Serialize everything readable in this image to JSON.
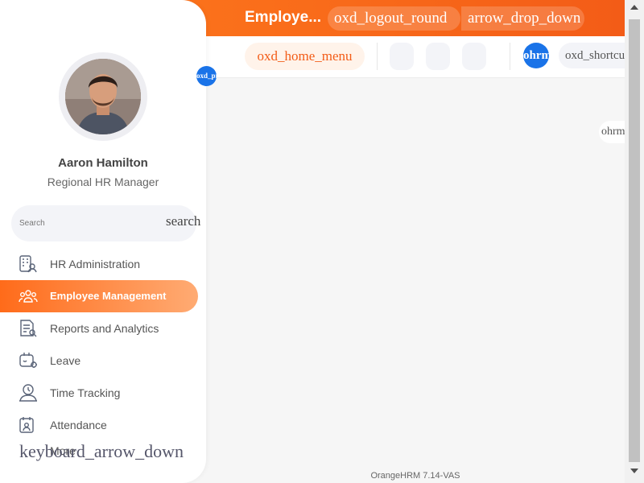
{
  "header": {
    "title": "Employe...",
    "logout_icon_text": "oxd_logout_round",
    "dropdown_icon_text": "arrow_drop_down"
  },
  "subbar": {
    "home_menu_text": "oxd_home_menu",
    "ohrm_badge": "ohrm",
    "shortcut_text": "oxd_shortcut"
  },
  "floating_badge": "ohrm",
  "blue_chip": "oxd_pr",
  "user": {
    "name": "Aaron Hamilton",
    "role": "Regional HR Manager"
  },
  "search": {
    "placeholder": "Search",
    "icon_text": "search"
  },
  "sidebar": {
    "items": [
      {
        "label": "HR Administration",
        "icon": "building-user-icon",
        "active": false
      },
      {
        "label": "Employee Management",
        "icon": "users-group-icon",
        "active": true
      },
      {
        "label": "Reports and Analytics",
        "icon": "report-icon",
        "active": false
      },
      {
        "label": "Leave",
        "icon": "leave-icon",
        "active": false
      },
      {
        "label": "Time Tracking",
        "icon": "clock-user-icon",
        "active": false
      },
      {
        "label": "Attendance",
        "icon": "attendance-icon",
        "active": false
      }
    ],
    "more_label": "More",
    "more_icon_text": "keyboard_arrow_down"
  },
  "footer": "OrangeHRM 7.14-VAS",
  "colors": {
    "brand_orange": "#f35c17",
    "accent_blue": "#1a73e8"
  }
}
